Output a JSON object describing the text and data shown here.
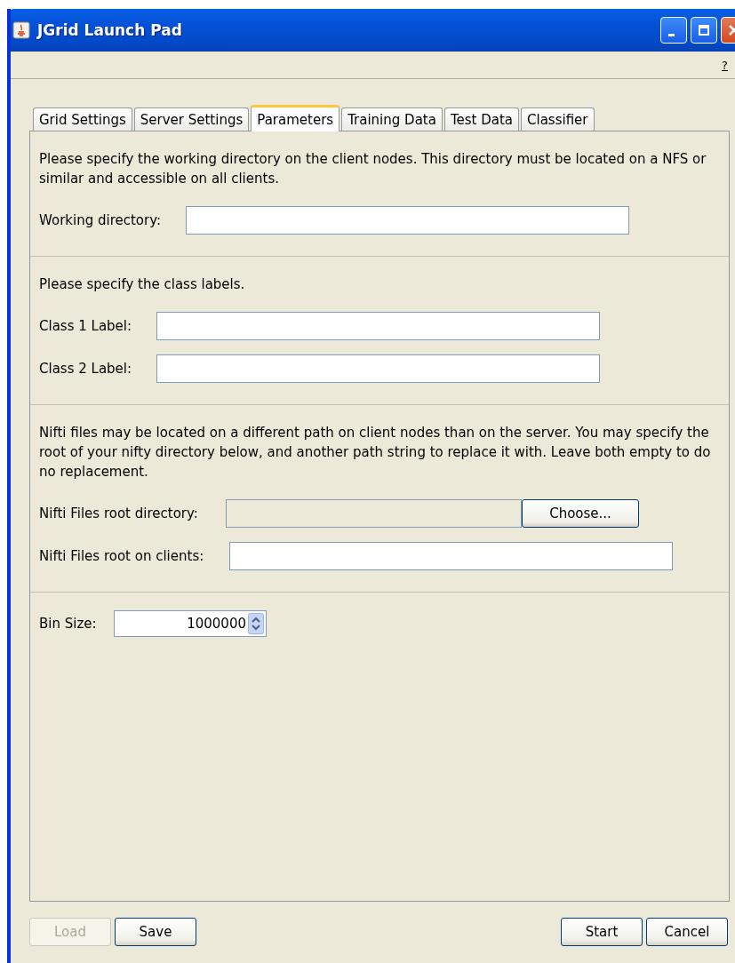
{
  "window": {
    "title": "JGrid Launch Pad"
  },
  "help": "?",
  "tabs": [
    {
      "label": "Grid Settings",
      "selected": false
    },
    {
      "label": "Server Settings",
      "selected": false
    },
    {
      "label": "Parameters",
      "selected": true
    },
    {
      "label": "Training Data",
      "selected": false
    },
    {
      "label": "Test Data",
      "selected": false
    },
    {
      "label": "Classifier",
      "selected": false
    }
  ],
  "sections": [
    {
      "description": "Please specify the working directory on the client nodes. This directory must be located on a NFS or similar and accessible on all clients.",
      "fields": [
        {
          "kind": "text",
          "label": "Working directory:",
          "disabled": false
        }
      ]
    },
    {
      "description": "Please specify the class labels.",
      "fields": [
        {
          "kind": "text",
          "label": "Class 1 Label:",
          "disabled": false
        },
        {
          "kind": "text",
          "label": "Class 2 Label:",
          "disabled": false
        }
      ]
    },
    {
      "description": "Nifti files may be located on a different path on client nodes than on the server. You may specify the root of your nifty directory below, and another path string to replace it with. Leave both empty to do no replacement.",
      "fields": [
        {
          "kind": "file",
          "label": "Nifti Files root directory:",
          "disabled": true,
          "button": "Choose..."
        },
        {
          "kind": "text",
          "label": "Nifti Files root on clients:",
          "disabled": false
        }
      ]
    },
    {
      "fields": [
        {
          "kind": "spinner",
          "label": "Bin Size:",
          "value": "1000000"
        }
      ]
    }
  ],
  "left_buttons": [
    {
      "label": "Load",
      "disabled": true
    },
    {
      "label": "Save",
      "disabled": false
    }
  ],
  "right_buttons": [
    {
      "label": "Start",
      "disabled": false
    },
    {
      "label": "Cancel",
      "disabled": false
    }
  ]
}
